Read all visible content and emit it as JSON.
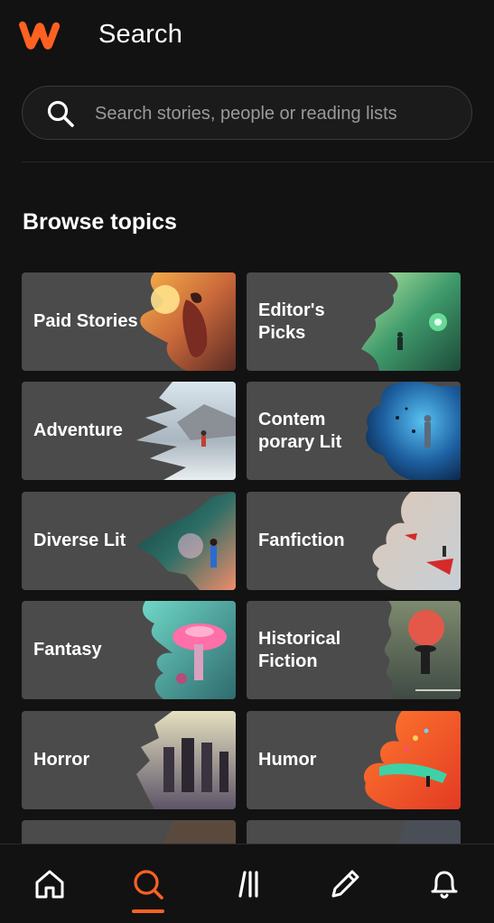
{
  "header": {
    "title": "Search",
    "logo_icon": "wattpad-w-logo-icon"
  },
  "search": {
    "placeholder": "Search stories, people or reading lists",
    "icon": "search-icon"
  },
  "browse": {
    "title": "Browse topics",
    "topics": [
      {
        "label": "Paid Stories",
        "art": "paid-stories-artwork"
      },
      {
        "label": "Editor's\nPicks",
        "art": "editors-picks-artwork"
      },
      {
        "label": "Adventure",
        "art": "adventure-artwork"
      },
      {
        "label": "Contem\nporary Lit",
        "art": "contemporary-lit-artwork"
      },
      {
        "label": "Diverse Lit",
        "art": "diverse-lit-artwork"
      },
      {
        "label": "Fanfiction",
        "art": "fanfiction-artwork"
      },
      {
        "label": "Fantasy",
        "art": "fantasy-artwork"
      },
      {
        "label": "Historical\nFiction",
        "art": "historical-fiction-artwork"
      },
      {
        "label": "Horror",
        "art": "horror-artwork"
      },
      {
        "label": "Humor",
        "art": "humor-artwork"
      },
      {
        "label": "",
        "art": ""
      },
      {
        "label": "",
        "art": ""
      }
    ]
  },
  "nav": {
    "items": [
      "home-icon",
      "search-icon",
      "library-icon",
      "write-icon",
      "notifications-icon"
    ],
    "active": "search"
  },
  "colors": {
    "accent": "#ff6122",
    "background": "#121212",
    "card": "#4b4b4b"
  }
}
